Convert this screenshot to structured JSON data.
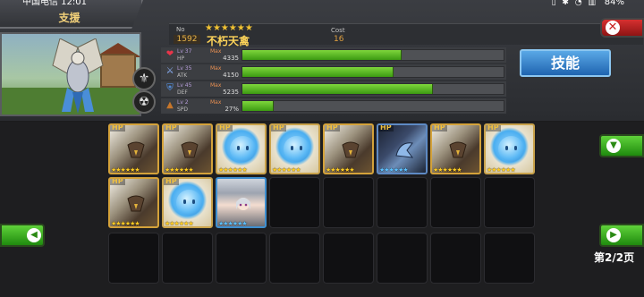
{
  "status_bar": {
    "carrier_time": "中国电信 12:01",
    "battery": "84%",
    "icons": "▯ ✱ ◔ ▥"
  },
  "header": {
    "title": "支援",
    "number_label": "No",
    "number_value": "1592",
    "stars": "★★★★★★",
    "unit_name": "不朽天禽",
    "cost_label": "Cost",
    "cost_value": "16",
    "close_icon": "✕",
    "skill_button": "技能"
  },
  "stats": [
    {
      "icon": "heart-icon",
      "glyph": "❤",
      "color": "#e8354a",
      "lv": "Lv 37",
      "name": "HP",
      "max": "Max",
      "value": "4335",
      "fill": 0.61
    },
    {
      "icon": "sword-icon",
      "glyph": "⚔",
      "color": "#8fb6ff",
      "lv": "Lv 35",
      "name": "ATK",
      "max": "Max",
      "value": "4150",
      "fill": 0.58
    },
    {
      "icon": "shield-icon",
      "glyph": "⛨",
      "color": "#5aa0ff",
      "lv": "Lv 45",
      "name": "DEF",
      "max": "Max",
      "value": "5235",
      "fill": 0.73
    },
    {
      "icon": "boot-icon",
      "glyph": "▲",
      "color": "#c6762a",
      "lv": "Lv 2",
      "name": "SPD",
      "max": "Max",
      "value": "27%",
      "fill": 0.12
    }
  ],
  "cards": [
    {
      "type": "eagle",
      "hp": "HP",
      "stars": "★★★★★★",
      "blue": false
    },
    {
      "type": "eagle",
      "hp": "HP",
      "stars": "★★★★★★",
      "blue": false
    },
    {
      "type": "slime",
      "hp": "HP",
      "stars": "★★★★★★",
      "blue": false
    },
    {
      "type": "slime",
      "hp": "HP",
      "stars": "★★★★★★",
      "blue": false
    },
    {
      "type": "eagle",
      "hp": "HP",
      "stars": "★★★★★★",
      "blue": false
    },
    {
      "type": "dragon",
      "hp": "HP",
      "stars": "★★★★★★",
      "blue": true
    },
    {
      "type": "eagle",
      "hp": "HP",
      "stars": "★★★★★★",
      "blue": false
    },
    {
      "type": "slime",
      "hp": "HP",
      "stars": "★★★★★★",
      "blue": false
    },
    {
      "type": "eagle",
      "hp": "HP",
      "stars": "★★★★★★",
      "blue": false
    },
    {
      "type": "slime",
      "hp": "HP",
      "stars": "★★★★★★",
      "blue": false
    },
    {
      "type": "girl",
      "hp": "",
      "stars": "★★★★★★",
      "blue": true
    }
  ],
  "nav": {
    "filter_icon": "▼",
    "prev_icon": "◀",
    "next_icon": "▶",
    "page_label": "第2/2页"
  }
}
